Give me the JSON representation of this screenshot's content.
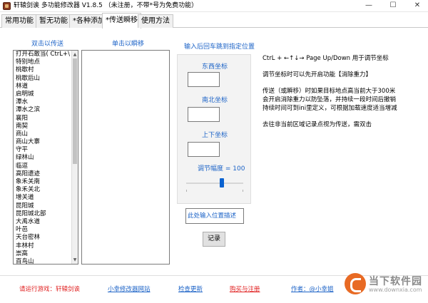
{
  "window": {
    "title": "轩辕剑诶  多功能修改器  V1.8.5  （未注册，不带*号为免费功能）",
    "min_label": "—",
    "max_label": "☐",
    "close_label": "✕"
  },
  "tabs": [
    "常用功能",
    "暂无功能",
    "*各种添加",
    "*传送瞬移",
    "使用方法"
  ],
  "left_panel": {
    "label": "双击以传送",
    "items": [
      "打开石敢当( CtrL+\\ )",
      "特别地点",
      "桃歇村",
      "桃歇后山",
      "林道",
      "启明城",
      "潭水",
      "潭水之滨",
      "襄阳",
      "南契",
      "商山",
      "商山大寨",
      "守平",
      "绿林山",
      "临逗",
      "高阳遗迹",
      "象禾关南",
      "象禾关北",
      "增关道",
      "昆阳城",
      "昆阳城北部",
      "大禹水道",
      "叶邑",
      "天台密林",
      "丰林村",
      "崇高",
      "百鸟山"
    ]
  },
  "mid_panel": {
    "label": "单击以瞬移",
    "items": []
  },
  "coord": {
    "header": "输入后回车跳到指定位置",
    "ew_label": "东西坐标",
    "ns_label": "南北坐标",
    "ud_label": "上下坐标",
    "ew_value": "",
    "ns_value": "",
    "ud_value": "",
    "adjust_label": "调节幅度 = 100",
    "slider_value": 100
  },
  "desc_input": {
    "placeholder": "此处输入位置描述"
  },
  "record_button": "记录",
  "help": {
    "line1": "CtrL + ←↑↓→ Page Up/Down 用于调节坐标",
    "line2": "调节坐标时可以先开启功能【消除重力】",
    "line3": "传送（或瞬移）时如果目标地点高当前大于300米",
    "line4": "会开启消除重力以防坠落，并持续一段时间后撤销",
    "line5": "持续时间可到ini里定义，可根据加载速度适当增减",
    "line6": "去往非当前区域记录点视为传送，需双击"
  },
  "footer": {
    "game": "请运行游戏：轩辕剑诶",
    "site": "小幸修改器网站",
    "update": "检查更新",
    "buy": "购买与注册",
    "author": "作者：@小幸姐"
  },
  "watermark": {
    "name": "当下软件园",
    "url": "www.downxia.com"
  },
  "colors": {
    "accent": "#1c63c7",
    "warning": "#e02020",
    "slider": "#0a62d0"
  }
}
